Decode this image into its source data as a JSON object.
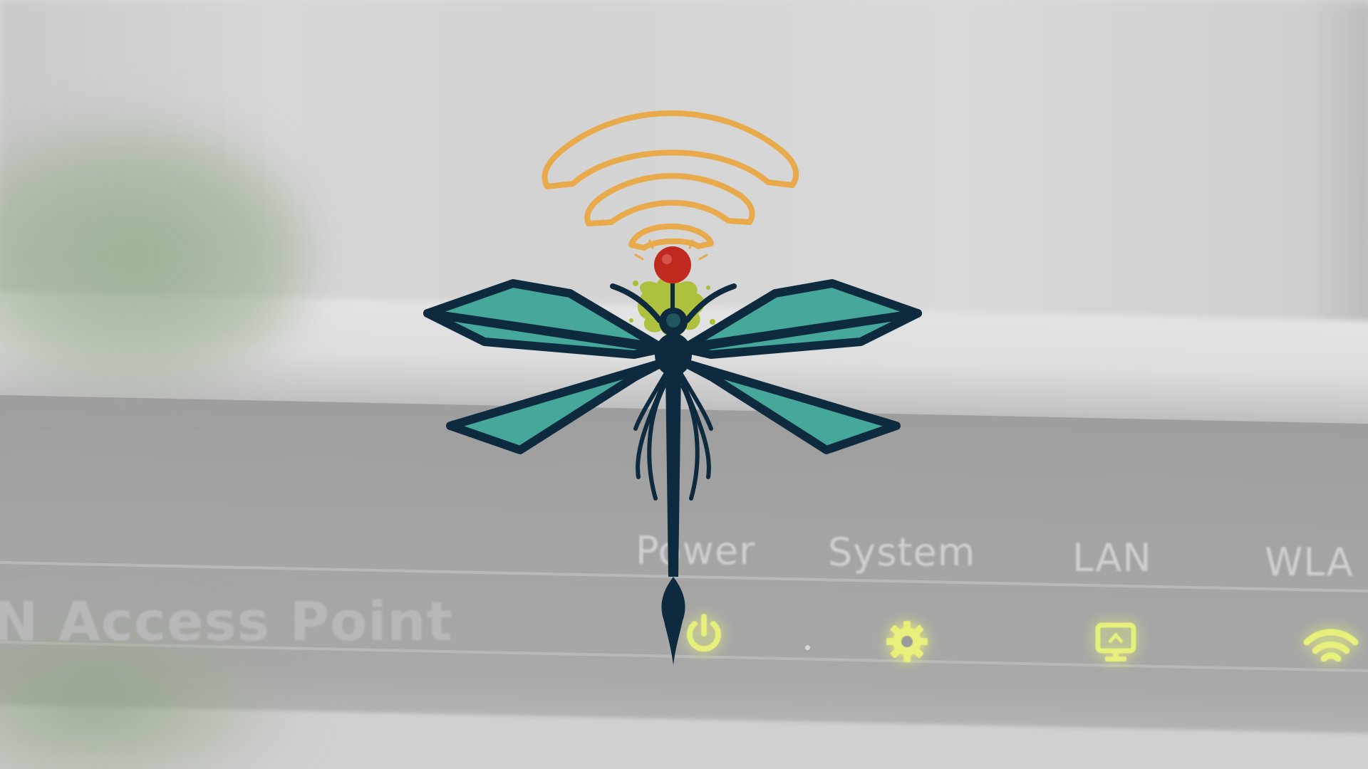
{
  "device": {
    "model_label": "N Access Point",
    "indicators": [
      {
        "label": "Power",
        "icon": "power-icon"
      },
      {
        "label": "System",
        "icon": "gear-icon"
      },
      {
        "label": "LAN",
        "icon": "lan-monitor-icon"
      },
      {
        "label": "WLA",
        "icon": "wifi-icon"
      }
    ]
  },
  "logo": {
    "icon": "dragonfly-wifi-logo",
    "colors": {
      "wifi_arcs": "#E8AA4A",
      "wings": "#45A89A",
      "outline": "#0E2A3E",
      "head": "#C0291E",
      "splash": "#AABF2E"
    }
  },
  "led_color": "#E6F07A"
}
